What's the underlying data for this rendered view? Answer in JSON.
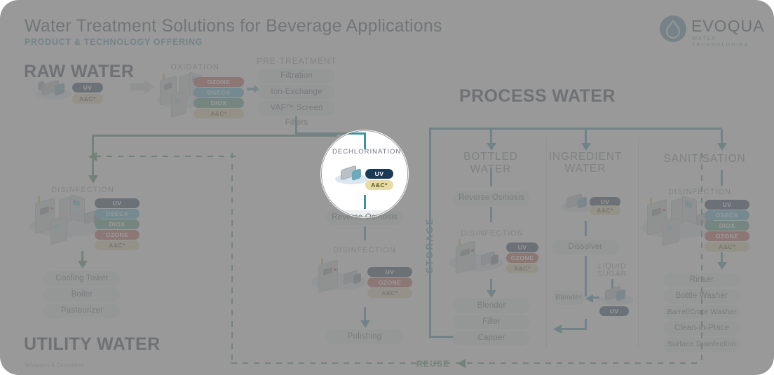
{
  "header": {
    "title": "Water Treatment Solutions for Beverage Applications",
    "subtitle": "PRODUCT & TECHNOLOGY OFFERING",
    "logo_name": "EVOQUA",
    "logo_tagline": "WATER TECHNOLOGIES"
  },
  "titles": {
    "raw_water": "RAW WATER",
    "process_water": "PROCESS WATER",
    "utility_water": "UTILITY WATER"
  },
  "raw_water": {
    "intake_pills": [
      "UV",
      "A&C*"
    ],
    "oxidation_label": "OXIDATION",
    "oxidation_pills": [
      "OZONE",
      "OSEC® Systems",
      "DIOX",
      "A&C*"
    ]
  },
  "pretreatment": {
    "label": "PRE-TREATMENT",
    "options": [
      "Filtration",
      "Ion-Exchange",
      "VAF™ Screen Filters"
    ]
  },
  "dechlorination": {
    "label": "DECHLORINATION",
    "pills": [
      "UV",
      "A&C*"
    ]
  },
  "utility": {
    "disinfection_label": "DISINFECTION",
    "disinfection_pills": [
      "UV",
      "OSEC® Systems",
      "DIOX",
      "OZONE",
      "A&C*"
    ],
    "outputs": [
      "Cooling Tower",
      "Boiler",
      "Pasteurizer"
    ]
  },
  "center_column": {
    "reverse_osmosis": "Reverse Osmosis",
    "disinfection_label": "DISINFECTION",
    "disinfection_pills": [
      "UV",
      "OZONE",
      "A&C*"
    ],
    "polishing": "Polishing",
    "storage_label": "STORAGE"
  },
  "bottled_water": {
    "label": "BOTTLED WATER",
    "reverse_osmosis": "Reverse Osmosis",
    "disinfection_label": "DISINFECTION",
    "disinfection_pills": [
      "UV",
      "OZONE",
      "A&C*"
    ],
    "outputs": [
      "Blender",
      "Filler",
      "Capper"
    ]
  },
  "ingredient_water": {
    "label": "INGREDIENT WATER",
    "pills": [
      "UV",
      "A&C*"
    ],
    "dissolver": "Dissolver",
    "liquid_sugar_label": "LIQUID SUGAR",
    "liquid_sugar_pills": [
      "UV"
    ],
    "blender": "Blender"
  },
  "sanitisation": {
    "label": "SANITISATION",
    "disinfection_label": "DISINFECTION",
    "disinfection_pills": [
      "UV",
      "OSEC® Systems",
      "DIOX",
      "OZONE",
      "A&C*"
    ],
    "outputs": [
      "Rinser",
      "Bottle Washer",
      "Barrel/Crate Washer",
      "Clean-in-Place",
      "Surface Disinfection"
    ]
  },
  "reuse": {
    "label": "REUSE"
  },
  "footnote": "*Analysers & Controllers",
  "colors": {
    "uv": "#1b3a55",
    "osec": "#45b3cf",
    "diox": "#4e9e84",
    "ozone": "#c2584a",
    "ac": "#e7dca8",
    "teal": "#3f93a8",
    "green": "#4e8c63",
    "brand_dark": "#2f3b47"
  }
}
